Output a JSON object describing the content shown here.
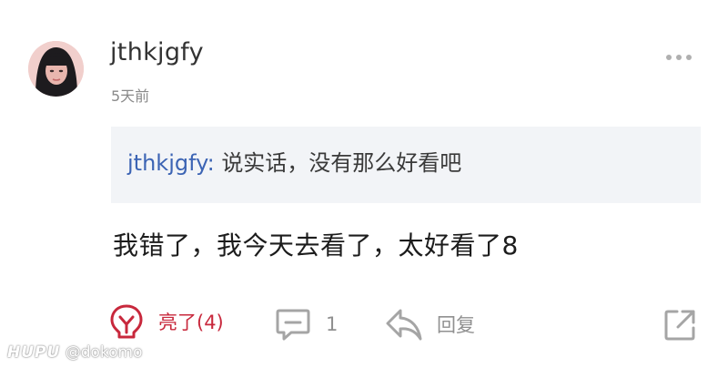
{
  "user": {
    "name": "jthkjgfy",
    "time": "5天前"
  },
  "quote": {
    "author": "jthkjgfy",
    "separator": ":",
    "text": "说实话，没有那么好看吧"
  },
  "reply": {
    "text": "我错了，我今天去看了，太好看了8"
  },
  "actions": {
    "like_label": "亮了(4)",
    "comment_count": "1",
    "reply_label": "回复"
  },
  "watermark": {
    "brand": "HUPU",
    "handle": "@dokomo"
  },
  "colors": {
    "accent": "#c8283c",
    "link": "#3c64b4",
    "muted": "#909090",
    "quote_bg": "#f2f4f7"
  },
  "icons": [
    "avatar-image",
    "more-dots-icon",
    "like-bulb-icon",
    "comment-icon",
    "reply-arrow-icon",
    "share-icon"
  ]
}
